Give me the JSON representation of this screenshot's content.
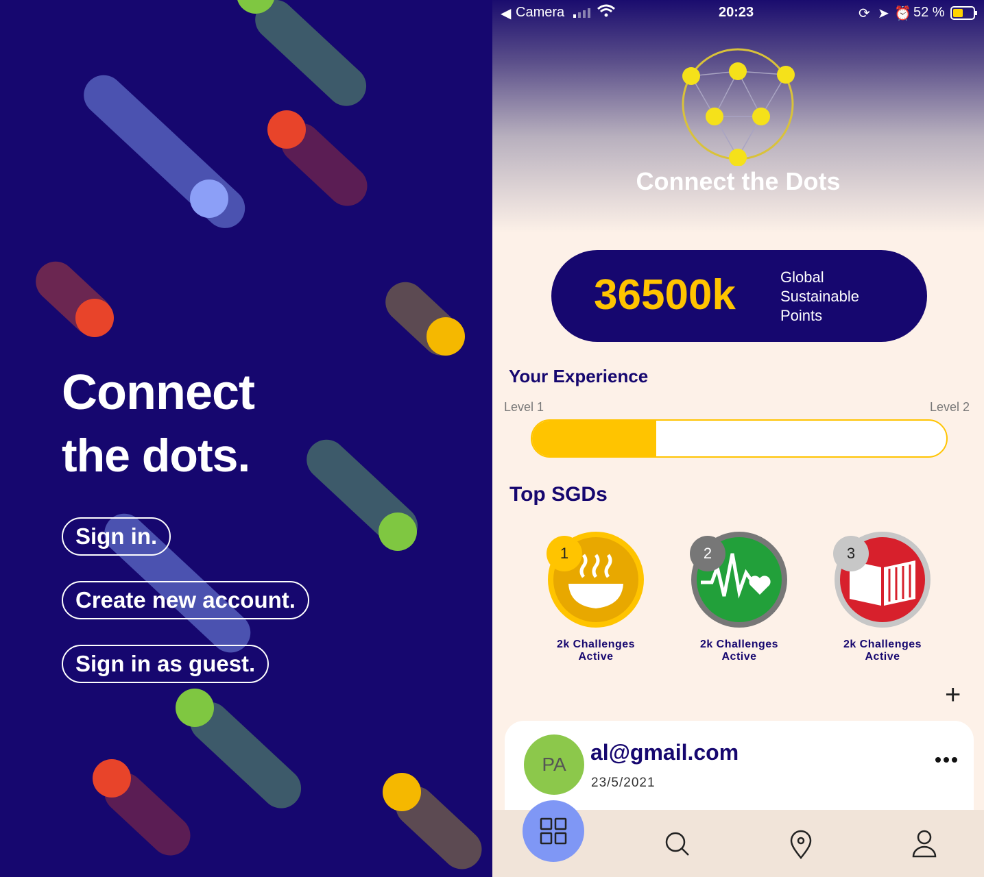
{
  "splash": {
    "headline_line1": "Connect",
    "headline_line2": "the dots.",
    "buttons": {
      "sign_in": "Sign in.",
      "create_account": "Create new account.",
      "guest": "Sign in as guest."
    }
  },
  "status_bar": {
    "back_app": "Camera",
    "time": "20:23",
    "battery": "52 %"
  },
  "app": {
    "title": "Connect the Dots",
    "points": {
      "value": "36500k",
      "label_line1": "Global",
      "label_line2": "Sustainable",
      "label_line3": "Points"
    },
    "experience": {
      "title": "Your Experience",
      "level_from": "Level 1",
      "level_to": "Level 2",
      "progress": 0.3
    },
    "top_sdgs": {
      "title": "Top SGDs",
      "items": [
        {
          "rank": "1",
          "caption_line1": "2k Challenges",
          "caption_line2": "Active",
          "icon": "food-bowl-icon",
          "color": "#f5b800"
        },
        {
          "rank": "2",
          "caption_line1": "2k Challenges",
          "caption_line2": "Active",
          "icon": "health-heartbeat-icon",
          "color": "#22a03a"
        },
        {
          "rank": "3",
          "caption_line1": "2k Challenges",
          "caption_line2": "Active",
          "icon": "book-icon",
          "color": "#d7202c"
        }
      ]
    },
    "post": {
      "avatar_initials": "PA",
      "email": "al@gmail.com",
      "date": "23/5/2021"
    }
  },
  "colors": {
    "navy": "#16076f",
    "yellow": "#ffc400",
    "cream": "#fdf1e8",
    "active_nav": "#7f97f5"
  }
}
